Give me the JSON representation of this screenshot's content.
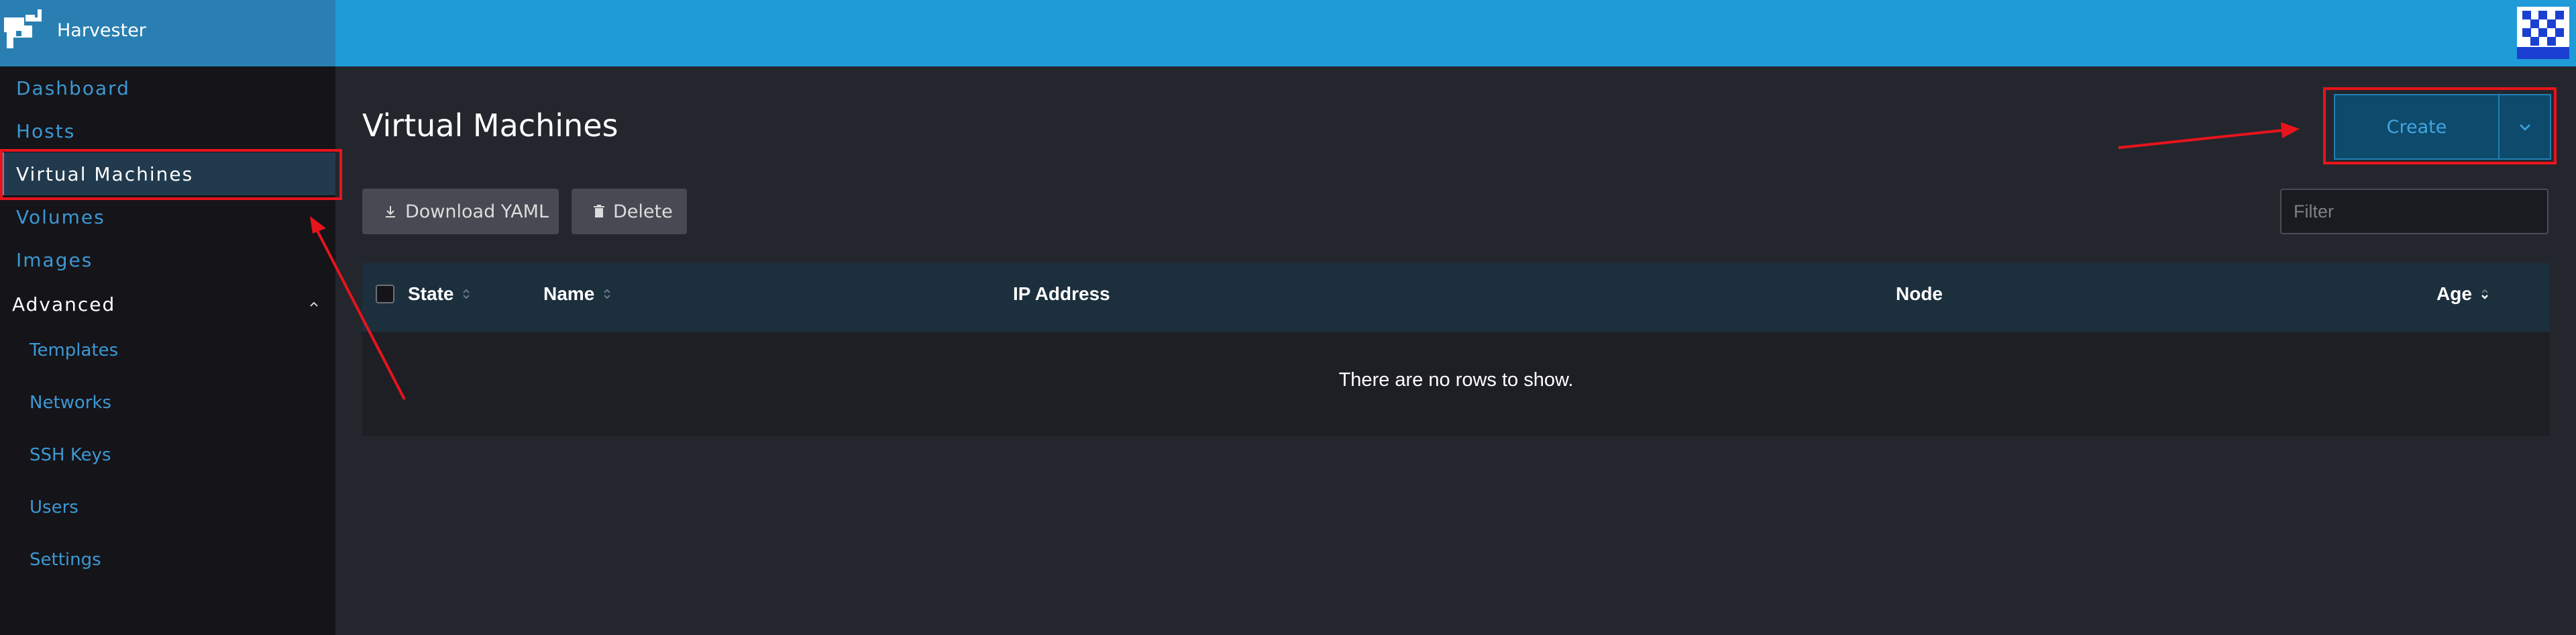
{
  "header": {
    "app_name": "Harvester",
    "colors": {
      "topbar": "#1f9bd7",
      "brand": "#2a7fb2",
      "accent": "#3d98d3"
    }
  },
  "sidebar": {
    "items": [
      {
        "label": "Dashboard"
      },
      {
        "label": "Hosts"
      },
      {
        "label": "Virtual Machines",
        "active": true
      },
      {
        "label": "Volumes"
      },
      {
        "label": "Images"
      }
    ],
    "group": {
      "label": "Advanced",
      "items": [
        {
          "label": "Templates"
        },
        {
          "label": "Networks"
        },
        {
          "label": "SSH Keys"
        },
        {
          "label": "Users"
        },
        {
          "label": "Settings"
        }
      ]
    }
  },
  "main": {
    "title": "Virtual Machines",
    "create_label": "Create",
    "download_label": "Download YAML",
    "delete_label": "Delete",
    "filter_placeholder": "Filter",
    "table": {
      "columns": [
        "State",
        "Name",
        "IP Address",
        "Node",
        "Age"
      ],
      "empty_message": "There are no rows to show."
    }
  },
  "annotations": {
    "color": "#e8141c"
  }
}
